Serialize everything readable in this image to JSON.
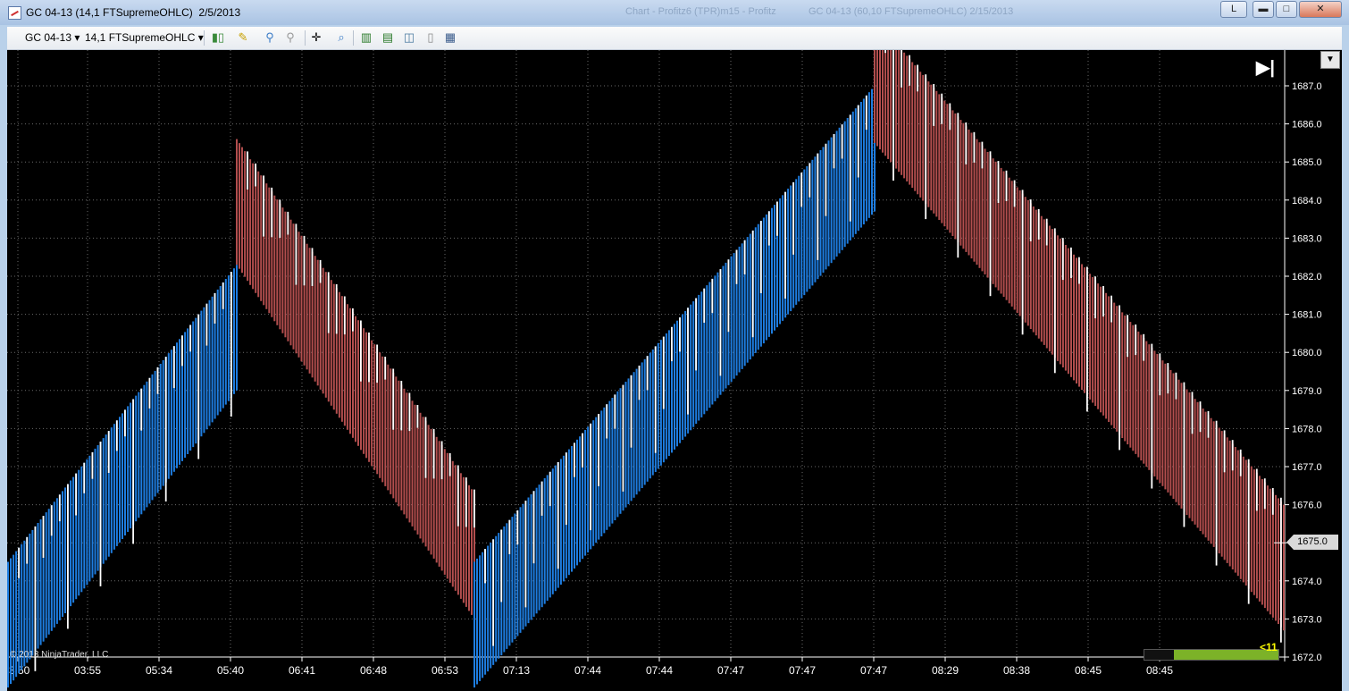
{
  "window": {
    "title": "GC 04-13 (14,1 FTSupremeOHLC)  2/5/2013",
    "ghost_tab_1": "Chart - Profitz6 (TPR)m15 - Profitz",
    "ghost_tab_2": "GC 04-13 (60,10 FTSupremeOHLC)  2/15/2013",
    "buttons": {
      "link": "L",
      "minimize": "▬",
      "maximize": "□",
      "close": "✕"
    }
  },
  "toolbar": {
    "instrument": "GC 04-13",
    "bar_type": "14,1 FTSupremeOHLC",
    "icons": [
      "bar-style-icon",
      "drawing-pencil-icon",
      "pin-icon",
      "pin-gray-icon",
      "crosshair-icon",
      "zoom-icon",
      "data-box-icon",
      "indicators-icon",
      "strategies-icon",
      "properties-icon",
      "templates-icon"
    ]
  },
  "chart": {
    "copyright": "© 2013 NinjaTrader, LLC",
    "current_price_label": "1675.0",
    "countdown": "<11",
    "countdown_fraction": 0.78,
    "jump_to_end": "▶|",
    "price_axis": [
      "1687.0",
      "1686.0",
      "1685.0",
      "1684.0",
      "1683.0",
      "1682.0",
      "1681.0",
      "1680.0",
      "1679.0",
      "1678.0",
      "1677.0",
      "1676.0",
      "1675.0",
      "1674.0",
      "1673.0",
      "1672.0"
    ],
    "time_axis": [
      "3:50",
      "03:55",
      "05:34",
      "05:40",
      "06:41",
      "06:48",
      "06:53",
      "07:13",
      "07:44",
      "07:44",
      "07:47",
      "07:47",
      "07:47",
      "08:29",
      "08:38",
      "08:45",
      "08:45"
    ],
    "colors": {
      "up": "#1e7de0",
      "down": "#b24e4e",
      "wick": "#ffffff",
      "grid": "#6a6a6a",
      "background": "#000000"
    }
  },
  "chart_data": {
    "type": "bar",
    "subtype": "ohlc-renko-like",
    "instrument": "GC 04-13",
    "ylim": [
      1672,
      1687.5
    ],
    "segments": [
      {
        "direction": "up",
        "start_time": "3:50",
        "end_time": "05:40",
        "start_price": 1674.5,
        "end_price": 1682.3
      },
      {
        "direction": "down",
        "start_time": "05:40",
        "end_time": "06:53",
        "start_price": 1682.3,
        "end_price": 1673.0
      },
      {
        "direction": "up",
        "start_time": "06:53",
        "end_time": "07:47",
        "start_price": 1674.5,
        "end_price": 1687.0
      },
      {
        "direction": "down",
        "start_time": "07:47",
        "end_time": "08:45",
        "start_price": 1685.5,
        "end_price": 1672.7
      }
    ],
    "last_price": 1675.0
  }
}
